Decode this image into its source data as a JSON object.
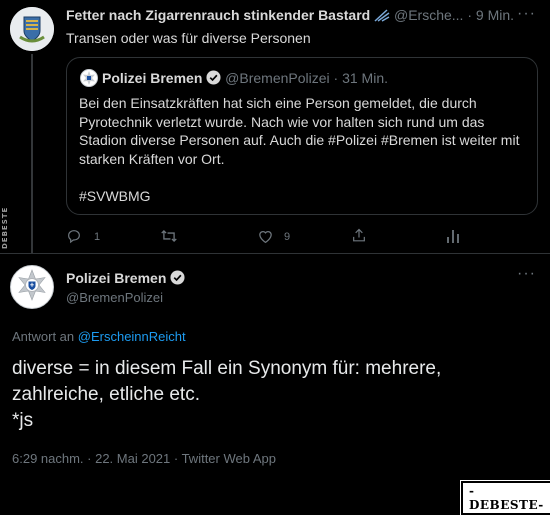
{
  "tweet1": {
    "author_name": "Fetter nach Zigarrenrauch stinkender Bastard",
    "author_handle": "@Ersche...",
    "separator": "·",
    "time": "9 Min.",
    "text": "Transen oder was für diverse Personen",
    "more_label": "···"
  },
  "quoted": {
    "author_name": "Polizei Bremen",
    "author_handle": "@BremenPolizei",
    "separator": "·",
    "time": "31 Min.",
    "text": "Bei den Einsatzkräften hat sich eine Person gemeldet, die durch\nPyrotechnik verletzt wurde. Nach wie vor halten sich rund um das\nStadion diverse Personen auf. Auch die #Polizei #Bremen ist weiter mit\nstarken Kräften vor Ort.\n\n#SVWBMG"
  },
  "tweet1_actions": {
    "reply_count": "1",
    "retweet_count": "",
    "like_count": "9"
  },
  "tweet2": {
    "author_name": "Polizei Bremen",
    "author_handle": "@BremenPolizei",
    "more_label": "···",
    "reply_prefix": "Antwort an ",
    "reply_to": "@ErscheinnReicht",
    "text": "diverse = in diesem Fall ein Synonym für: mehrere,\nzahlreiche, etliche etc.\n*js",
    "meta": "6:29 nachm. · 22. Mai 2021 · Twitter Web App"
  },
  "watermarks": {
    "side": "DEBESTE",
    "bottom": "-DEBESTE-"
  },
  "colors": {
    "background": "#000000",
    "text": "#d9d9d9",
    "muted": "#6e767d",
    "link": "#1d9bf0",
    "verified": "#d9d9d9"
  }
}
